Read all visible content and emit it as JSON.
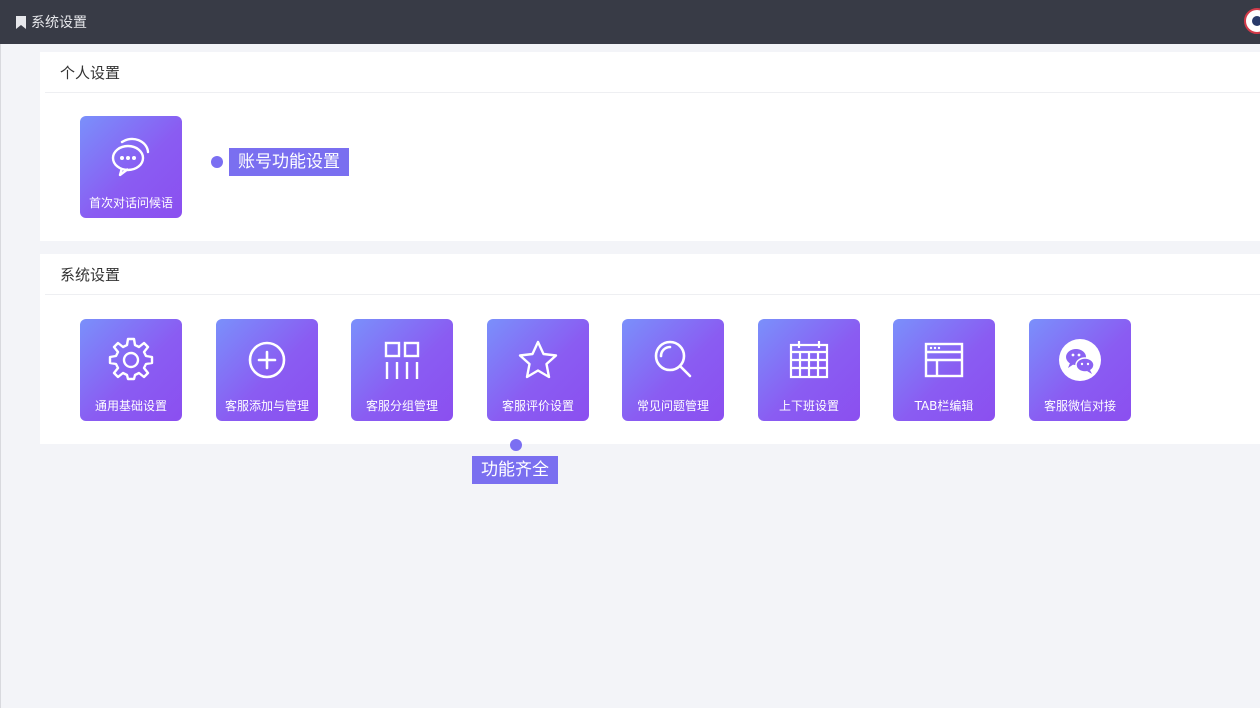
{
  "topbar": {
    "title": "系统设置"
  },
  "personal": {
    "heading": "个人设置",
    "tiles": [
      {
        "label": "首次对话问候语",
        "icon": "chat-bubbles-icon"
      }
    ],
    "callout": "账号功能设置"
  },
  "system": {
    "heading": "系统设置",
    "tiles": [
      {
        "label": "通用基础设置",
        "icon": "gear-icon"
      },
      {
        "label": "客服添加与管理",
        "icon": "plus-circle-icon"
      },
      {
        "label": "客服分组管理",
        "icon": "group-grid-icon"
      },
      {
        "label": "客服评价设置",
        "icon": "star-icon"
      },
      {
        "label": "常见问题管理",
        "icon": "search-icon"
      },
      {
        "label": "上下班设置",
        "icon": "calendar-icon"
      },
      {
        "label": "TAB栏编辑",
        "icon": "window-layout-icon"
      },
      {
        "label": "客服微信对接",
        "icon": "wechat-icon"
      }
    ],
    "callout": "功能齐全"
  },
  "colors": {
    "topbar": "#383b46",
    "tile_start": "#7a90fb",
    "tile_end": "#8b4ff0",
    "callout": "#7a6ff0"
  }
}
